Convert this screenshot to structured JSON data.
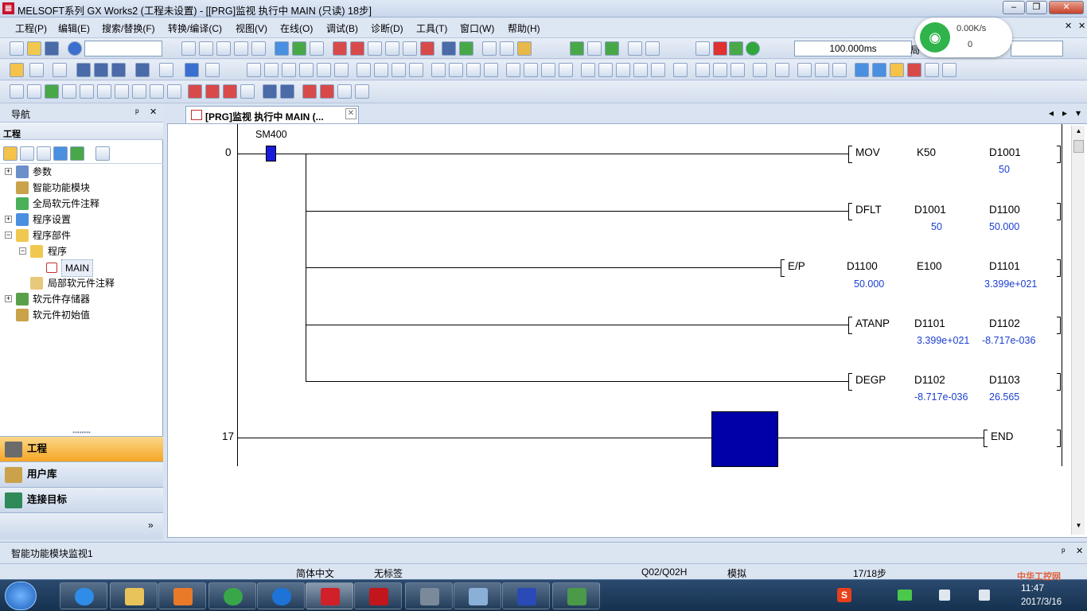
{
  "window": {
    "title": "MELSOFT系列 GX Works2 (工程未设置) - [[PRG]监视 执行中 MAIN (只读) 18步]",
    "minimize": "–",
    "restore": "❐",
    "close": "✕"
  },
  "menu": [
    "工程(P)",
    "编辑(E)",
    "搜索/替换(F)",
    "转换/编译(C)",
    "视图(V)",
    "在线(O)",
    "调试(B)",
    "诊断(D)",
    "工具(T)",
    "窗口(W)",
    "帮助(H)"
  ],
  "toolbar": {
    "scan_time": "100.000ms",
    "scope_label": "局"
  },
  "network_widget": {
    "speed": "0.00K/s",
    "count": "0"
  },
  "nav": {
    "title": "导航",
    "pin": "ᵖ",
    "close": "✕",
    "section": "工程",
    "tree": [
      {
        "label": "参数",
        "level": 0,
        "expander": "+"
      },
      {
        "label": "智能功能模块",
        "level": 0,
        "expander": ""
      },
      {
        "label": "全局软元件注释",
        "level": 0,
        "expander": ""
      },
      {
        "label": "程序设置",
        "level": 0,
        "expander": "+"
      },
      {
        "label": "程序部件",
        "level": 0,
        "expander": "−"
      },
      {
        "label": "程序",
        "level": 1,
        "expander": "−"
      },
      {
        "label": "MAIN",
        "level": 2,
        "expander": ""
      },
      {
        "label": "局部软元件注释",
        "level": 1,
        "expander": ""
      },
      {
        "label": "软元件存储器",
        "level": 0,
        "expander": "+"
      },
      {
        "label": "软元件初始值",
        "level": 0,
        "expander": ""
      }
    ],
    "buttons": [
      "工程",
      "用户库",
      "连接目标"
    ],
    "more": "»"
  },
  "editor": {
    "tab_label": "[PRG]监视 执行中 MAIN (...",
    "tab_close": "✕",
    "nav_prev": "◂",
    "nav_next": "▸",
    "nav_menu": "▾"
  },
  "ladder": {
    "contact": "SM400",
    "step0": "0",
    "step17": "17",
    "rows": [
      {
        "op": "MOV",
        "a1": "K50",
        "a2": "D1001",
        "v1": "",
        "v2": "50"
      },
      {
        "op": "DFLT",
        "a1": "D1001",
        "a2": "D1100",
        "v1": "50",
        "v2": "50.000"
      },
      {
        "op": "E/P",
        "a0": "D1100",
        "a1": "E100",
        "a2": "D1101",
        "v0": "50.000",
        "v1": "",
        "v2": "3.399e+021"
      },
      {
        "op": "ATANP",
        "a1": "D1101",
        "a2": "D1102",
        "v1": "3.399e+021",
        "v2": "-8.717e-036"
      },
      {
        "op": "DEGP",
        "a1": "D1102",
        "a2": "D1103",
        "v1": "-8.717e-036",
        "v2": "26.565"
      }
    ],
    "end": "END"
  },
  "bottom_panel": {
    "title": "智能功能模块监视1",
    "pin": "ᵖ",
    "close": "✕"
  },
  "status": {
    "ime": "简体中文",
    "label": "无标签",
    "cpu": "Q02/Q02H",
    "mode": "模拟",
    "steps": "17/18步"
  },
  "taskbar": {
    "time": "11:47",
    "date": "2017/3/16",
    "tray_s": "S",
    "watermark": "中华工控网"
  },
  "colors": {
    "accent": "#f5a623",
    "selection": "#0000a8",
    "contact": "#1a1adb",
    "value": "#1a3fcf"
  }
}
